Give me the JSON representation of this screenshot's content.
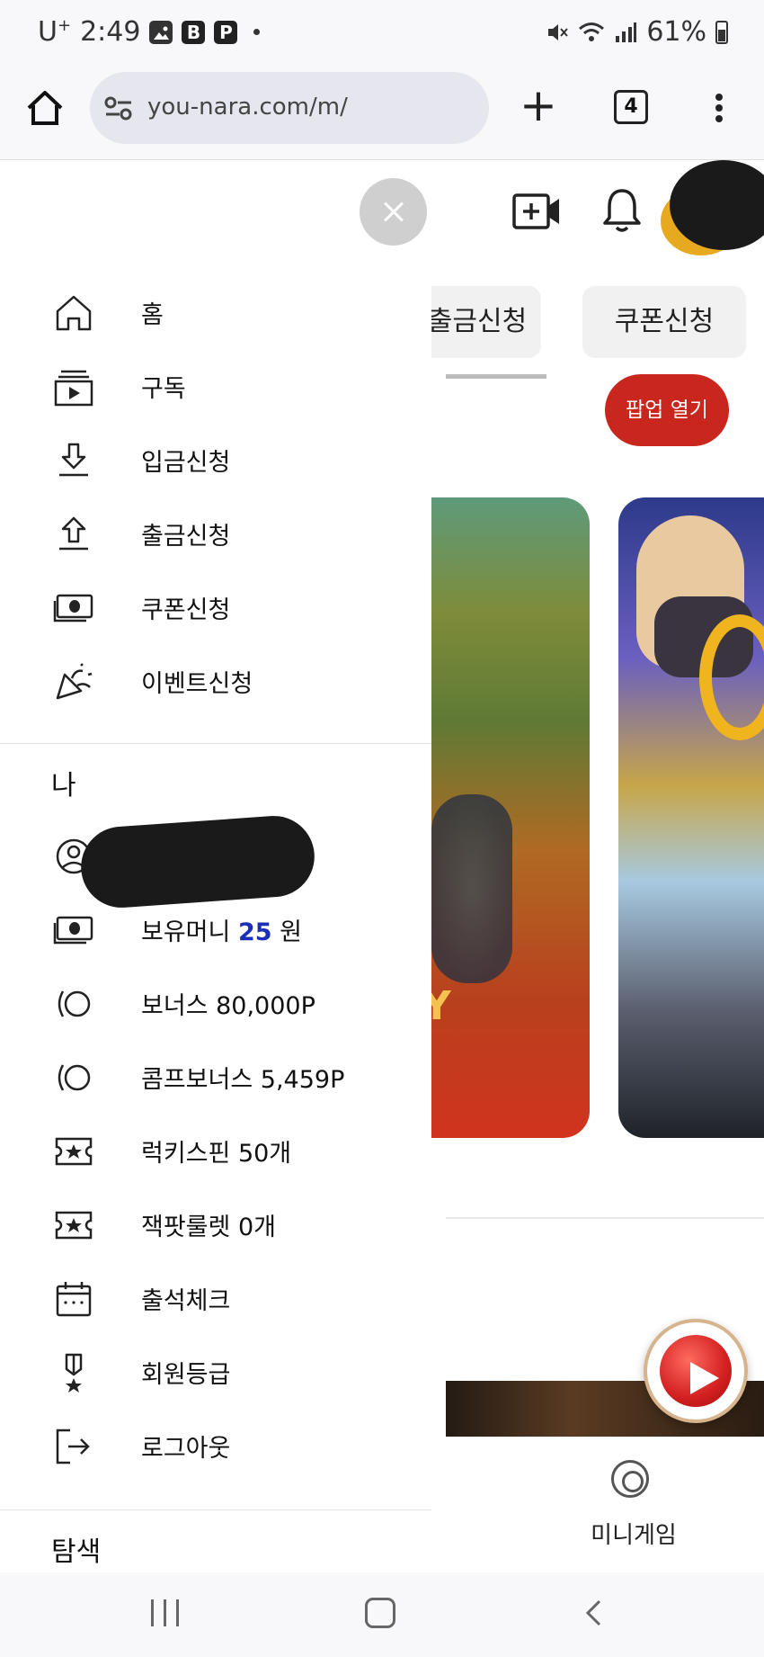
{
  "status_bar": {
    "carrier": "U",
    "carrier_sup": "+",
    "time": "2:49",
    "icon_b": "B",
    "icon_p": "P",
    "battery": "61%"
  },
  "browser": {
    "url": "you-nara.com/m/",
    "tab_count": "4"
  },
  "background_page": {
    "chips": [
      "출금신청",
      "쿠폰신청"
    ],
    "popup_button": "팝업 열기",
    "banner_text": "AY",
    "mini_game_label": "미니게임"
  },
  "drawer": {
    "main_items": [
      {
        "label": "홈",
        "icon": "home-icon"
      },
      {
        "label": "구독",
        "icon": "subscriptions-icon"
      },
      {
        "label": "입금신청",
        "icon": "download-icon"
      },
      {
        "label": "출금신청",
        "icon": "upload-icon"
      },
      {
        "label": "쿠폰신청",
        "icon": "money-icon"
      },
      {
        "label": "이벤트신청",
        "icon": "party-popper-icon"
      }
    ],
    "me_section": {
      "title": "나",
      "money_prefix": "보유머니 ",
      "money_value": "25",
      "money_suffix": " 원",
      "items": [
        {
          "label": "보너스 80,000P",
          "icon": "points-icon"
        },
        {
          "label": "콤프보너스 5,459P",
          "icon": "points-icon"
        },
        {
          "label": "럭키스핀 50개",
          "icon": "ticket-star-icon"
        },
        {
          "label": "잭팟룰렛 0개",
          "icon": "ticket-star-icon"
        },
        {
          "label": "출석체크",
          "icon": "calendar-icon"
        },
        {
          "label": "회원등급",
          "icon": "medal-icon"
        },
        {
          "label": "로그아웃",
          "icon": "logout-icon"
        }
      ]
    },
    "explore_title": "탐색"
  },
  "colors": {
    "popup_red": "#c9271e",
    "money_blue": "#1a2fb6"
  }
}
